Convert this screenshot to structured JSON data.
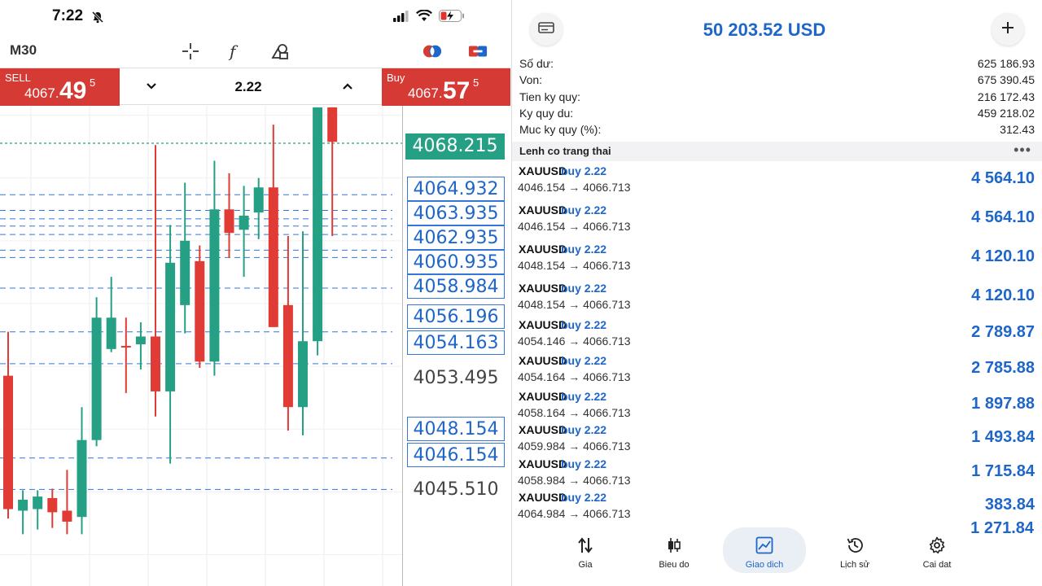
{
  "status_bar": {
    "time": "7:22"
  },
  "chart_toolbar": {
    "timeframe": "M30"
  },
  "trade_bar": {
    "sell": {
      "label": "SELL",
      "price_small": "4067.",
      "price_big": "49",
      "price_sup": "5"
    },
    "lot": "2.22",
    "buy": {
      "label": "Buy",
      "price_small": "4067.",
      "price_big": "57",
      "price_sup": "5"
    }
  },
  "price_labels": {
    "bid": "4068.215",
    "orders": [
      "4064.932",
      "4063.935",
      "4062.935",
      "4060.935",
      "4058.984",
      "4056.196",
      "4054.163",
      "4048.154",
      "4046.154"
    ],
    "axis": [
      "4053.495",
      "4045.510"
    ]
  },
  "colors": {
    "bull": "#26a084",
    "bear": "#e03b34",
    "accent": "#1f66c9",
    "sell_buy_bg": "#d63a35"
  },
  "chart_data": {
    "type": "candlestick",
    "symbol": "XAUUSD",
    "timeframe": "M30",
    "ohlc": [
      {
        "o": 4053.4,
        "h": 4056.2,
        "l": 4044.3,
        "c": 4044.9
      },
      {
        "o": 4044.8,
        "h": 4046.1,
        "l": 4043.3,
        "c": 4045.5
      },
      {
        "o": 4044.9,
        "h": 4046.1,
        "l": 4043.6,
        "c": 4045.7
      },
      {
        "o": 4045.6,
        "h": 4046.2,
        "l": 4043.7,
        "c": 4044.7
      },
      {
        "o": 4044.8,
        "h": 4047.4,
        "l": 4043.3,
        "c": 4044.1
      },
      {
        "o": 4044.4,
        "h": 4051.4,
        "l": 4043.3,
        "c": 4049.3
      },
      {
        "o": 4049.3,
        "h": 4058.4,
        "l": 4048.9,
        "c": 4057.1
      },
      {
        "o": 4055.1,
        "h": 4059.7,
        "l": 4054.9,
        "c": 4057.1
      },
      {
        "o": 4055.3,
        "h": 4057.1,
        "l": 4052.3,
        "c": 4055.2
      },
      {
        "o": 4055.4,
        "h": 4056.8,
        "l": 4053.8,
        "c": 4055.9
      },
      {
        "o": 4055.9,
        "h": 4068.1,
        "l": 4050.8,
        "c": 4052.4
      },
      {
        "o": 4052.4,
        "h": 4063.0,
        "l": 4047.8,
        "c": 4060.6
      },
      {
        "o": 4057.9,
        "h": 4065.7,
        "l": 4056.1,
        "c": 4062.0
      },
      {
        "o": 4060.7,
        "h": 4061.7,
        "l": 4053.9,
        "c": 4054.3
      },
      {
        "o": 4054.3,
        "h": 4067.1,
        "l": 4053.4,
        "c": 4064.0
      },
      {
        "o": 4064.0,
        "h": 4066.3,
        "l": 4060.9,
        "c": 4062.5
      },
      {
        "o": 4062.7,
        "h": 4065.5,
        "l": 4059.7,
        "c": 4063.6
      },
      {
        "o": 4063.8,
        "h": 4066.0,
        "l": 4062.1,
        "c": 4065.4
      },
      {
        "o": 4065.4,
        "h": 4069.4,
        "l": 4056.6,
        "c": 4056.5
      },
      {
        "o": 4057.9,
        "h": 4062.3,
        "l": 4049.9,
        "c": 4051.4
      },
      {
        "o": 4051.4,
        "h": 4062.6,
        "l": 4049.6,
        "c": 4055.6
      },
      {
        "o": 4055.6,
        "h": 4070.5,
        "l": 4054.7,
        "c": 4070.5
      },
      {
        "o": 4070.5,
        "h": 4070.5,
        "l": 4062.3,
        "c": 4068.3
      }
    ],
    "ylim": [
      4040.0,
      4070.6
    ],
    "order_levels": [
      4064.932,
      4063.935,
      4062.935,
      4060.935,
      4058.984,
      4056.196,
      4054.163,
      4048.154,
      4046.154
    ],
    "extra_dashed_levels": [
      4063.4,
      4062.4,
      4061.4
    ],
    "bid_level": 4068.215
  },
  "account": {
    "balance_title": "50 203.52 USD",
    "rows": [
      {
        "label": "Số dư:",
        "value": "625 186.93"
      },
      {
        "label": "Von:",
        "value": "675 390.45"
      },
      {
        "label": "Tien ky quy:",
        "value": "216 172.43"
      },
      {
        "label": "Ky quy du:",
        "value": "459 218.02"
      },
      {
        "label": "Muc ky quy (%):",
        "value": "312.43"
      }
    ]
  },
  "positions_section": {
    "title": "Lenh co trang thai",
    "more": "•••"
  },
  "positions": [
    {
      "symbol": "XAUUSD",
      "side": "buy 2.22",
      "prices": "4046.154 → 4066.713",
      "profit": "4 564.10"
    },
    {
      "symbol": "XAUUSD",
      "side": "buy 2.22",
      "prices": "4046.154 → 4066.713",
      "profit": "4 564.10"
    },
    {
      "symbol": "XAUUSD",
      "side": "buy 2.22",
      "prices": "4048.154 → 4066.713",
      "profit": "4 120.10"
    },
    {
      "symbol": "XAUUSD",
      "side": "buy 2.22",
      "prices": "4048.154 → 4066.713",
      "profit": "4 120.10"
    },
    {
      "symbol": "XAUUSD",
      "side": "buy 2.22",
      "prices": "4054.146 → 4066.713",
      "profit": "2 789.87"
    },
    {
      "symbol": "XAUUSD",
      "side": "buy 2.22",
      "prices": "4054.164 → 4066.713",
      "profit": "2 785.88"
    },
    {
      "symbol": "XAUUSD",
      "side": "buy 2.22",
      "prices": "4058.164 → 4066.713",
      "profit": "1 897.88"
    },
    {
      "symbol": "XAUUSD",
      "side": "buy 2.22",
      "prices": "4059.984 → 4066.713",
      "profit": "1 493.84"
    },
    {
      "symbol": "XAUUSD",
      "side": "buy 2.22",
      "prices": "4058.984 → 4066.713",
      "profit": "1 715.84"
    },
    {
      "symbol": "XAUUSD",
      "side": "buy 2.22",
      "prices": "4064.984 → 4066.713",
      "profit": "383.84"
    }
  ],
  "floating_profit": "1 271.84",
  "tabs": [
    {
      "label": "Gia",
      "icon": "sort-arrows-icon"
    },
    {
      "label": "Bieu do",
      "icon": "candles-icon"
    },
    {
      "label": "Giao dich",
      "icon": "trade-chart-icon",
      "active": true
    },
    {
      "label": "Lịch sử",
      "icon": "history-icon"
    },
    {
      "label": "Cai dat",
      "icon": "gear-icon"
    }
  ]
}
